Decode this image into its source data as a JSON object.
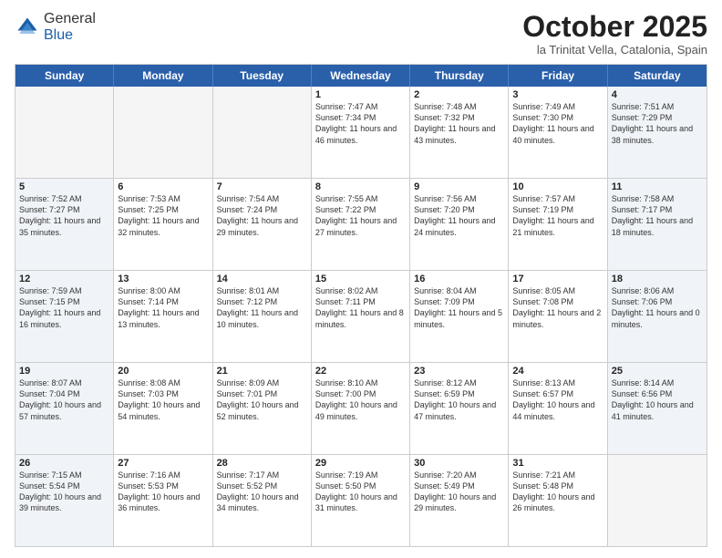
{
  "header": {
    "logo_general": "General",
    "logo_blue": "Blue",
    "month_title": "October 2025",
    "location": "la Trinitat Vella, Catalonia, Spain"
  },
  "day_headers": [
    "Sunday",
    "Monday",
    "Tuesday",
    "Wednesday",
    "Thursday",
    "Friday",
    "Saturday"
  ],
  "weeks": [
    [
      {
        "day": "",
        "empty": true
      },
      {
        "day": "",
        "empty": true
      },
      {
        "day": "",
        "empty": true
      },
      {
        "day": "1",
        "sunrise": "7:47 AM",
        "sunset": "7:34 PM",
        "daylight": "11 hours and 46 minutes."
      },
      {
        "day": "2",
        "sunrise": "7:48 AM",
        "sunset": "7:32 PM",
        "daylight": "11 hours and 43 minutes."
      },
      {
        "day": "3",
        "sunrise": "7:49 AM",
        "sunset": "7:30 PM",
        "daylight": "11 hours and 40 minutes."
      },
      {
        "day": "4",
        "sunrise": "7:51 AM",
        "sunset": "7:29 PM",
        "daylight": "11 hours and 38 minutes.",
        "weekend": true
      }
    ],
    [
      {
        "day": "5",
        "sunrise": "7:52 AM",
        "sunset": "7:27 PM",
        "daylight": "11 hours and 35 minutes.",
        "weekend": true
      },
      {
        "day": "6",
        "sunrise": "7:53 AM",
        "sunset": "7:25 PM",
        "daylight": "11 hours and 32 minutes."
      },
      {
        "day": "7",
        "sunrise": "7:54 AM",
        "sunset": "7:24 PM",
        "daylight": "11 hours and 29 minutes."
      },
      {
        "day": "8",
        "sunrise": "7:55 AM",
        "sunset": "7:22 PM",
        "daylight": "11 hours and 27 minutes."
      },
      {
        "day": "9",
        "sunrise": "7:56 AM",
        "sunset": "7:20 PM",
        "daylight": "11 hours and 24 minutes."
      },
      {
        "day": "10",
        "sunrise": "7:57 AM",
        "sunset": "7:19 PM",
        "daylight": "11 hours and 21 minutes."
      },
      {
        "day": "11",
        "sunrise": "7:58 AM",
        "sunset": "7:17 PM",
        "daylight": "11 hours and 18 minutes.",
        "weekend": true
      }
    ],
    [
      {
        "day": "12",
        "sunrise": "7:59 AM",
        "sunset": "7:15 PM",
        "daylight": "11 hours and 16 minutes.",
        "weekend": true
      },
      {
        "day": "13",
        "sunrise": "8:00 AM",
        "sunset": "7:14 PM",
        "daylight": "11 hours and 13 minutes."
      },
      {
        "day": "14",
        "sunrise": "8:01 AM",
        "sunset": "7:12 PM",
        "daylight": "11 hours and 10 minutes."
      },
      {
        "day": "15",
        "sunrise": "8:02 AM",
        "sunset": "7:11 PM",
        "daylight": "11 hours and 8 minutes."
      },
      {
        "day": "16",
        "sunrise": "8:04 AM",
        "sunset": "7:09 PM",
        "daylight": "11 hours and 5 minutes."
      },
      {
        "day": "17",
        "sunrise": "8:05 AM",
        "sunset": "7:08 PM",
        "daylight": "11 hours and 2 minutes."
      },
      {
        "day": "18",
        "sunrise": "8:06 AM",
        "sunset": "7:06 PM",
        "daylight": "11 hours and 0 minutes.",
        "weekend": true
      }
    ],
    [
      {
        "day": "19",
        "sunrise": "8:07 AM",
        "sunset": "7:04 PM",
        "daylight": "10 hours and 57 minutes.",
        "weekend": true
      },
      {
        "day": "20",
        "sunrise": "8:08 AM",
        "sunset": "7:03 PM",
        "daylight": "10 hours and 54 minutes."
      },
      {
        "day": "21",
        "sunrise": "8:09 AM",
        "sunset": "7:01 PM",
        "daylight": "10 hours and 52 minutes."
      },
      {
        "day": "22",
        "sunrise": "8:10 AM",
        "sunset": "7:00 PM",
        "daylight": "10 hours and 49 minutes."
      },
      {
        "day": "23",
        "sunrise": "8:12 AM",
        "sunset": "6:59 PM",
        "daylight": "10 hours and 47 minutes."
      },
      {
        "day": "24",
        "sunrise": "8:13 AM",
        "sunset": "6:57 PM",
        "daylight": "10 hours and 44 minutes."
      },
      {
        "day": "25",
        "sunrise": "8:14 AM",
        "sunset": "6:56 PM",
        "daylight": "10 hours and 41 minutes.",
        "weekend": true
      }
    ],
    [
      {
        "day": "26",
        "sunrise": "7:15 AM",
        "sunset": "5:54 PM",
        "daylight": "10 hours and 39 minutes.",
        "weekend": true
      },
      {
        "day": "27",
        "sunrise": "7:16 AM",
        "sunset": "5:53 PM",
        "daylight": "10 hours and 36 minutes."
      },
      {
        "day": "28",
        "sunrise": "7:17 AM",
        "sunset": "5:52 PM",
        "daylight": "10 hours and 34 minutes."
      },
      {
        "day": "29",
        "sunrise": "7:19 AM",
        "sunset": "5:50 PM",
        "daylight": "10 hours and 31 minutes."
      },
      {
        "day": "30",
        "sunrise": "7:20 AM",
        "sunset": "5:49 PM",
        "daylight": "10 hours and 29 minutes."
      },
      {
        "day": "31",
        "sunrise": "7:21 AM",
        "sunset": "5:48 PM",
        "daylight": "10 hours and 26 minutes."
      },
      {
        "day": "",
        "empty": true,
        "weekend": true
      }
    ]
  ],
  "labels": {
    "sunrise": "Sunrise:",
    "sunset": "Sunset:",
    "daylight": "Daylight:"
  }
}
